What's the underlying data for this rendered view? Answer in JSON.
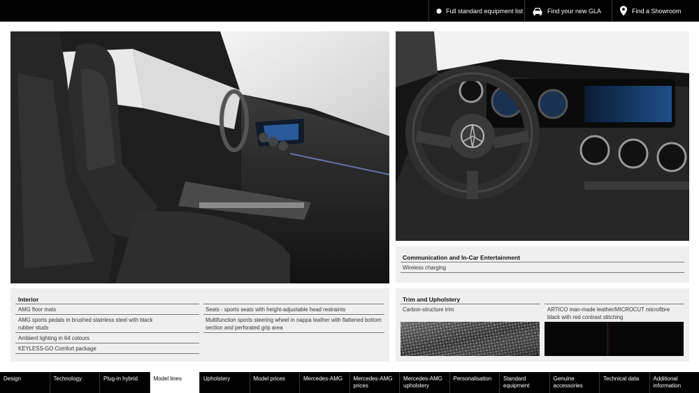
{
  "topbar": {
    "links": [
      {
        "label": "Full standard equipment list",
        "icon": "dot-icon"
      },
      {
        "label": "Find your new GLA",
        "icon": "car-icon"
      },
      {
        "label": "Find a Showroom",
        "icon": "location-pin-icon"
      }
    ]
  },
  "interior": {
    "title": "Interior",
    "col1": [
      "AMG floor mats",
      "AMG sports pedals in brushed stainless steel with black rubber studs",
      "Ambient lighting in 64 colours",
      "KEYLESS-GO Comfort package"
    ],
    "col2": [
      "Seats - sports seats with height-adjustable head restraints",
      "Multifunction sports steering wheel in nappa leather with flattened bottom section and perforated grip area"
    ]
  },
  "communication": {
    "title": "Communication and In-Car Entertainment",
    "items": [
      "Wireless charging"
    ]
  },
  "trim": {
    "title": "Trim and Upholstery",
    "items": [
      "Carbon-structure trim",
      "ARTICO man-made leather/MICROCUT microfibre black with red contrast stitching"
    ]
  },
  "nav": {
    "items": [
      "Design",
      "Technology",
      "Plug-in hybrid",
      "Model lines",
      "Upholstery",
      "Model prices",
      "Mercedes-AMG",
      "Mercedes-AMG prices",
      "Mercedes-AMG upholstery",
      "Personalisation",
      "Standard equipment",
      "Genuine accessories",
      "Technical data",
      "Additional information"
    ],
    "active_index": 3
  },
  "colors": {
    "bar": "#000000",
    "panel": "#efefef"
  }
}
